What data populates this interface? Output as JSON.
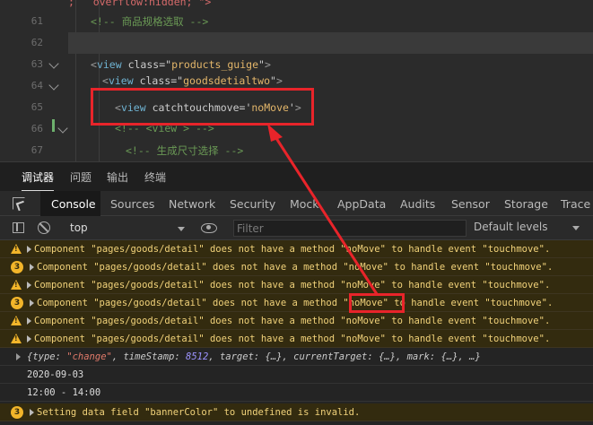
{
  "editor": {
    "lines": [
      {
        "num": "",
        "text": ";   overflow:hidden; \">"
      },
      {
        "num": "61",
        "text": "<!-- 商品规格选取 -->"
      },
      {
        "num": "62",
        "text": ""
      },
      {
        "num": "63",
        "tag": "view",
        "attr": "class",
        "value": "products_guige"
      },
      {
        "num": "64",
        "tag": "view",
        "attr": "class",
        "value": "goodsdetialtwo"
      },
      {
        "num": "65",
        "tag": "view",
        "attr": "catchtouchmove",
        "value": "noMove"
      },
      {
        "num": "66",
        "text": "<!-- <view > -->"
      },
      {
        "num": "67",
        "text": "<!-- 生成尺寸选择 -->"
      }
    ]
  },
  "panel_tabs": [
    "调试器",
    "问题",
    "输出",
    "终端"
  ],
  "devtools_tabs": [
    "Console",
    "Sources",
    "Network",
    "Security",
    "Mock",
    "AppData",
    "Audits",
    "Sensor",
    "Storage",
    "Trace"
  ],
  "filterbar": {
    "context": "top",
    "filter_placeholder": "Filter",
    "levels": "Default levels"
  },
  "console": {
    "warning_text": "Component \"pages/goods/detail\" does not have a method \"noMove\" to handle event \"touchmove\".",
    "badge_count": "3",
    "object_line": {
      "open": "{type: ",
      "type_value": "\"change\"",
      "mid": ", timeStamp: ",
      "timestamp": "8512",
      "rest": ", target: {…}, currentTarget: {…}, mark: {…}, …}"
    },
    "date": "2020-09-03",
    "time_range": "12:00 - 14:00",
    "last_warning": "Setting data field \"bannerColor\" to undefined is invalid."
  },
  "colors": {
    "annotation": "#e8242a",
    "warning": "#f2b52a"
  }
}
